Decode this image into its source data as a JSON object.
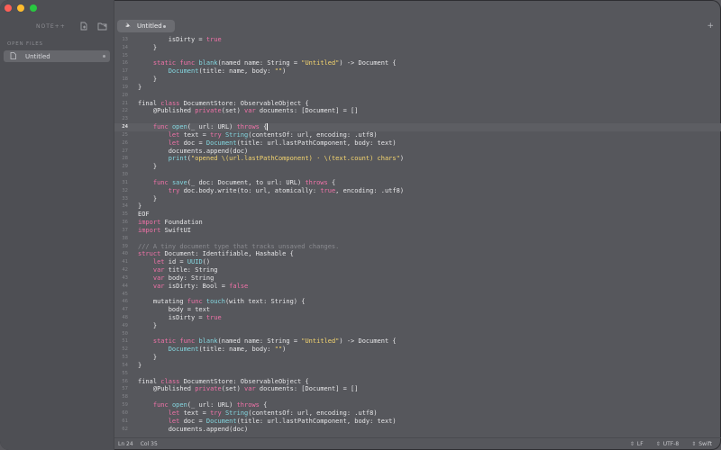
{
  "window": {
    "traffic_lights": {
      "close": "#fe5f57",
      "minimize": "#febc2e",
      "zoom": "#28c840"
    }
  },
  "sidebar": {
    "app_title": "NOTE++",
    "icons": [
      "new-file-icon",
      "open-folder-icon"
    ],
    "section_label": "OPEN FILES",
    "files": [
      {
        "label": "Untitled",
        "icon": "document-icon",
        "unsaved": true
      }
    ]
  },
  "tabbar": {
    "tabs": [
      {
        "label": "Untitled",
        "icon": "swift-icon",
        "unsaved": true
      }
    ],
    "add_label": "+"
  },
  "editor": {
    "active_line": "24",
    "lines": [
      {
        "n": "13",
        "tokens": [
          {
            "t": "        isDirty = "
          },
          {
            "t": "true",
            "c": "k"
          }
        ]
      },
      {
        "n": "14",
        "tokens": [
          {
            "t": "    }"
          }
        ]
      },
      {
        "n": "15",
        "tokens": []
      },
      {
        "n": "16",
        "tokens": [
          {
            "t": "    "
          },
          {
            "t": "static",
            "c": "k"
          },
          {
            "t": " "
          },
          {
            "t": "func",
            "c": "k"
          },
          {
            "t": " "
          },
          {
            "t": "blank",
            "c": "f"
          },
          {
            "t": "(named name: String = "
          },
          {
            "t": "\"Untitled\"",
            "c": "s"
          },
          {
            "t": ") -> Document {"
          }
        ]
      },
      {
        "n": "17",
        "tokens": [
          {
            "t": "        "
          },
          {
            "t": "Document",
            "c": "f"
          },
          {
            "t": "(title: name, body: "
          },
          {
            "t": "\"\"",
            "c": "s"
          },
          {
            "t": ")"
          }
        ]
      },
      {
        "n": "18",
        "tokens": [
          {
            "t": "    }"
          }
        ]
      },
      {
        "n": "19",
        "tokens": [
          {
            "t": "}"
          }
        ]
      },
      {
        "n": "20",
        "tokens": []
      },
      {
        "n": "21",
        "tokens": [
          {
            "t": "final "
          },
          {
            "t": "class",
            "c": "k"
          },
          {
            "t": " DocumentStore: ObservableObject {"
          }
        ]
      },
      {
        "n": "22",
        "tokens": [
          {
            "t": "    @Published "
          },
          {
            "t": "private",
            "c": "k"
          },
          {
            "t": "(set) "
          },
          {
            "t": "var",
            "c": "k"
          },
          {
            "t": " documents: [Document] = []"
          }
        ]
      },
      {
        "n": "23",
        "tokens": []
      },
      {
        "n": "24",
        "tokens": [
          {
            "t": "    "
          },
          {
            "t": "func",
            "c": "k"
          },
          {
            "t": " "
          },
          {
            "t": "open",
            "c": "f"
          },
          {
            "t": "(_ url: URL) "
          },
          {
            "t": "throws",
            "c": "k"
          },
          {
            "t": " {"
          },
          {
            "cursor": true
          }
        ],
        "active": true
      },
      {
        "n": "25",
        "tokens": [
          {
            "t": "        "
          },
          {
            "t": "let",
            "c": "k"
          },
          {
            "t": " text = "
          },
          {
            "t": "try",
            "c": "k"
          },
          {
            "t": " "
          },
          {
            "t": "String",
            "c": "f"
          },
          {
            "t": "(contentsOf: url, encoding: .utf8)"
          }
        ]
      },
      {
        "n": "26",
        "tokens": [
          {
            "t": "        "
          },
          {
            "t": "let",
            "c": "k"
          },
          {
            "t": " doc = "
          },
          {
            "t": "Document",
            "c": "f"
          },
          {
            "t": "(title: url.lastPathComponent, body: text)"
          }
        ]
      },
      {
        "n": "27",
        "tokens": [
          {
            "t": "        documents.append(doc)"
          }
        ]
      },
      {
        "n": "28",
        "tokens": [
          {
            "t": "        "
          },
          {
            "t": "print",
            "c": "f"
          },
          {
            "t": "(",
            "c": ""
          },
          {
            "t": "\"opened \\(url.lastPathComponent) · \\(text.count) chars\"",
            "c": "s"
          },
          {
            "t": ")"
          }
        ]
      },
      {
        "n": "29",
        "tokens": [
          {
            "t": "    }"
          }
        ]
      },
      {
        "n": "30",
        "tokens": []
      },
      {
        "n": "31",
        "tokens": [
          {
            "t": "    "
          },
          {
            "t": "func",
            "c": "k"
          },
          {
            "t": " "
          },
          {
            "t": "save",
            "c": "f"
          },
          {
            "t": "(_ doc: Document, to url: URL) "
          },
          {
            "t": "throws",
            "c": "k"
          },
          {
            "t": " {"
          }
        ]
      },
      {
        "n": "32",
        "tokens": [
          {
            "t": "        "
          },
          {
            "t": "try",
            "c": "k"
          },
          {
            "t": " doc.body.write(to: url, atomically: "
          },
          {
            "t": "true",
            "c": "k"
          },
          {
            "t": ", encoding: .utf8)"
          }
        ]
      },
      {
        "n": "33",
        "tokens": [
          {
            "t": "    }"
          }
        ]
      },
      {
        "n": "34",
        "tokens": [
          {
            "t": "}"
          }
        ]
      },
      {
        "n": "35",
        "tokens": [
          {
            "t": "EOF"
          }
        ]
      },
      {
        "n": "36",
        "tokens": [
          {
            "t": "import",
            "c": "k"
          },
          {
            "t": " Foundation"
          }
        ]
      },
      {
        "n": "37",
        "tokens": [
          {
            "t": "import",
            "c": "k"
          },
          {
            "t": " SwiftUI"
          }
        ]
      },
      {
        "n": "38",
        "tokens": []
      },
      {
        "n": "39",
        "tokens": [
          {
            "t": "/// A tiny document type that tracks unsaved changes.",
            "c": "c"
          }
        ]
      },
      {
        "n": "40",
        "tokens": [
          {
            "t": "struct",
            "c": "k"
          },
          {
            "t": " Document: Identifiable, Hashable {"
          }
        ]
      },
      {
        "n": "41",
        "tokens": [
          {
            "t": "    "
          },
          {
            "t": "let",
            "c": "k"
          },
          {
            "t": " id = "
          },
          {
            "t": "UUID",
            "c": "f"
          },
          {
            "t": "()"
          }
        ]
      },
      {
        "n": "42",
        "tokens": [
          {
            "t": "    "
          },
          {
            "t": "var",
            "c": "k"
          },
          {
            "t": " title: String"
          }
        ]
      },
      {
        "n": "43",
        "tokens": [
          {
            "t": "    "
          },
          {
            "t": "var",
            "c": "k"
          },
          {
            "t": " body: String"
          }
        ]
      },
      {
        "n": "44",
        "tokens": [
          {
            "t": "    "
          },
          {
            "t": "var",
            "c": "k"
          },
          {
            "t": " isDirty: Bool = "
          },
          {
            "t": "false",
            "c": "k"
          }
        ]
      },
      {
        "n": "45",
        "tokens": []
      },
      {
        "n": "46",
        "tokens": [
          {
            "t": "    mutating "
          },
          {
            "t": "func",
            "c": "k"
          },
          {
            "t": " "
          },
          {
            "t": "touch",
            "c": "f"
          },
          {
            "t": "(with text: String) {"
          }
        ]
      },
      {
        "n": "47",
        "tokens": [
          {
            "t": "        body = text"
          }
        ]
      },
      {
        "n": "48",
        "tokens": [
          {
            "t": "        isDirty = "
          },
          {
            "t": "true",
            "c": "k"
          }
        ]
      },
      {
        "n": "49",
        "tokens": [
          {
            "t": "    }"
          }
        ]
      },
      {
        "n": "50",
        "tokens": []
      },
      {
        "n": "51",
        "tokens": [
          {
            "t": "    "
          },
          {
            "t": "static",
            "c": "k"
          },
          {
            "t": " "
          },
          {
            "t": "func",
            "c": "k"
          },
          {
            "t": " "
          },
          {
            "t": "blank",
            "c": "f"
          },
          {
            "t": "(named name: String = "
          },
          {
            "t": "\"Untitled\"",
            "c": "s"
          },
          {
            "t": ") -> Document {"
          }
        ]
      },
      {
        "n": "52",
        "tokens": [
          {
            "t": "        "
          },
          {
            "t": "Document",
            "c": "f"
          },
          {
            "t": "(title: name, body: "
          },
          {
            "t": "\"\"",
            "c": "s"
          },
          {
            "t": ")"
          }
        ]
      },
      {
        "n": "53",
        "tokens": [
          {
            "t": "    }"
          }
        ]
      },
      {
        "n": "54",
        "tokens": [
          {
            "t": "}"
          }
        ]
      },
      {
        "n": "55",
        "tokens": []
      },
      {
        "n": "56",
        "tokens": [
          {
            "t": "final "
          },
          {
            "t": "class",
            "c": "k"
          },
          {
            "t": " DocumentStore: ObservableObject {"
          }
        ]
      },
      {
        "n": "57",
        "tokens": [
          {
            "t": "    @Published "
          },
          {
            "t": "private",
            "c": "k"
          },
          {
            "t": "(set) "
          },
          {
            "t": "var",
            "c": "k"
          },
          {
            "t": " documents: [Document] = []"
          }
        ]
      },
      {
        "n": "58",
        "tokens": []
      },
      {
        "n": "59",
        "tokens": [
          {
            "t": "    "
          },
          {
            "t": "func",
            "c": "k"
          },
          {
            "t": " "
          },
          {
            "t": "open",
            "c": "f"
          },
          {
            "t": "(_ url: URL) "
          },
          {
            "t": "throws",
            "c": "k"
          },
          {
            "t": " {"
          }
        ]
      },
      {
        "n": "60",
        "tokens": [
          {
            "t": "        "
          },
          {
            "t": "let",
            "c": "k"
          },
          {
            "t": " text = "
          },
          {
            "t": "try",
            "c": "k"
          },
          {
            "t": " "
          },
          {
            "t": "String",
            "c": "f"
          },
          {
            "t": "(contentsOf: url, encoding: .utf8)"
          }
        ]
      },
      {
        "n": "61",
        "tokens": [
          {
            "t": "        "
          },
          {
            "t": "let",
            "c": "k"
          },
          {
            "t": " doc = "
          },
          {
            "t": "Document",
            "c": "f"
          },
          {
            "t": "(title: url.lastPathComponent, body: text)"
          }
        ]
      },
      {
        "n": "62",
        "tokens": [
          {
            "t": "        documents.append(doc)"
          }
        ]
      }
    ]
  },
  "statusbar": {
    "line": "Ln 24",
    "column": "Col 35",
    "line_ending": "LF",
    "encoding": "UTF-8",
    "language": "Swift"
  },
  "colors": {
    "keyword": "#f072a8",
    "function": "#84d7e0",
    "string": "#f6d66f",
    "comment": "#8a8b90"
  }
}
